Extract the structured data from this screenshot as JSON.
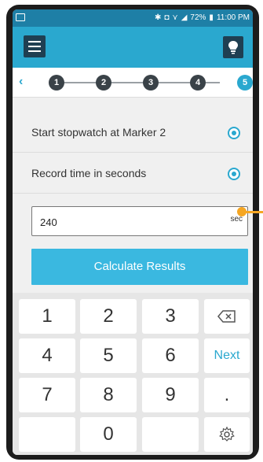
{
  "status": {
    "battery": "72%",
    "time": "11:00 PM"
  },
  "steps": {
    "items": [
      "1",
      "2",
      "3",
      "4",
      "5"
    ],
    "active": "5"
  },
  "options": [
    {
      "label": "Start stopwatch at Marker 2",
      "selected": true
    },
    {
      "label": "Record time in seconds",
      "selected": true
    }
  ],
  "input": {
    "value": "240",
    "unit": "sec"
  },
  "calculate_label": "Calculate Results",
  "keypad": {
    "keys": [
      "1",
      "2",
      "3",
      "4",
      "5",
      "6",
      "7",
      "8",
      "9",
      "0"
    ],
    "next_label": "Next",
    "dot_label": "."
  },
  "colors": {
    "appbar": "#2aa8cf",
    "accent": "#2aa8cf",
    "button": "#3ab8e0",
    "callout": "#f5a623"
  }
}
